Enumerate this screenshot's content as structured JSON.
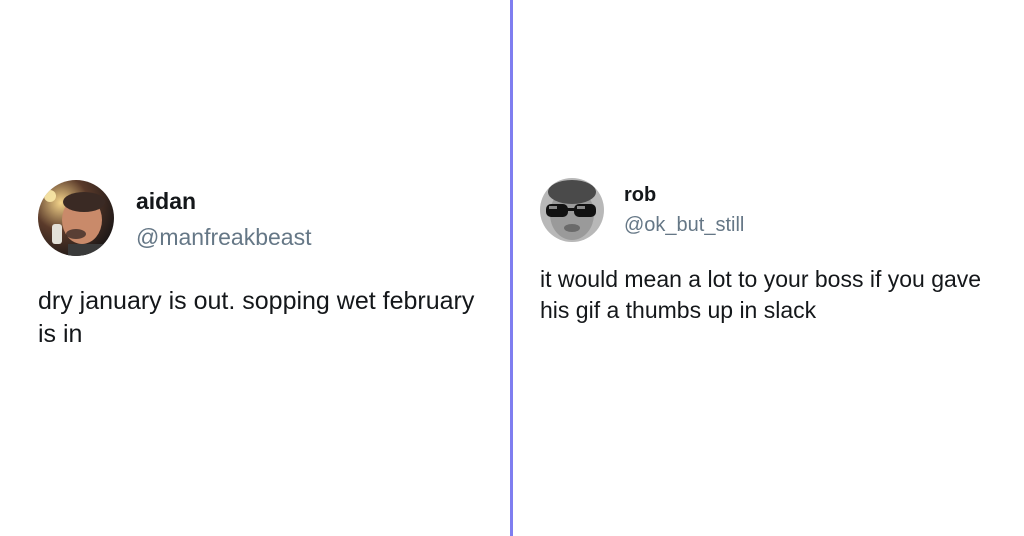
{
  "tweets": [
    {
      "name": "aidan",
      "handle": "@manfreakbeast",
      "text": "dry january is out. sopping wet february is in"
    },
    {
      "name": "rob",
      "handle": "@ok_but_still",
      "text": "it would mean a lot to your boss if you gave his gif a thumbs up in slack"
    }
  ],
  "colors": {
    "divider": "#7f7ef0",
    "name": "#14171a",
    "handle": "#657786",
    "text": "#14171a"
  }
}
